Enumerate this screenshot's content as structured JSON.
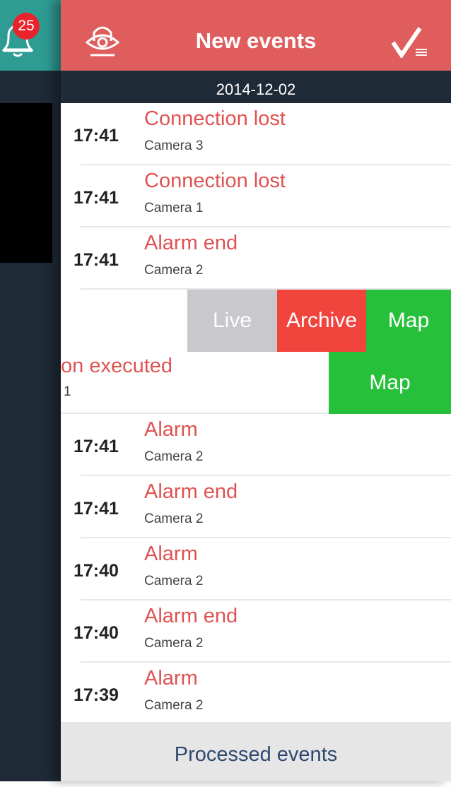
{
  "drawer": {
    "badge_count": "25"
  },
  "header": {
    "title": "New events"
  },
  "date_bar": {
    "date": "2014-12-02"
  },
  "events_top": [
    {
      "time": "17:41",
      "title": "Connection lost",
      "camera": "Camera 3"
    },
    {
      "time": "17:41",
      "title": "Connection lost",
      "camera": "Camera 1"
    },
    {
      "time": "17:41",
      "title": "Alarm end",
      "camera": "Camera 2"
    }
  ],
  "swipe_actions": {
    "live": "Live",
    "archive": "Archive",
    "map": "Map"
  },
  "partial_event": {
    "title_visible": "on executed",
    "camera_visible": "1",
    "map": "Map"
  },
  "events_bottom": [
    {
      "time": "17:41",
      "title": "Alarm",
      "camera": "Camera 2"
    },
    {
      "time": "17:41",
      "title": "Alarm end",
      "camera": "Camera 2"
    },
    {
      "time": "17:40",
      "title": "Alarm",
      "camera": "Camera 2"
    },
    {
      "time": "17:40",
      "title": "Alarm end",
      "camera": "Camera 2"
    },
    {
      "time": "17:39",
      "title": "Alarm",
      "camera": "Camera 2"
    }
  ],
  "footer": {
    "label": "Processed events"
  },
  "colors": {
    "header_red": "#e05d5d",
    "event_red": "#e05252",
    "drawer_dark": "#1f2a37",
    "teal": "#2e9c93",
    "live_gray": "#c8c8cd",
    "archive_red": "#f1443d",
    "map_green": "#27c03b"
  }
}
